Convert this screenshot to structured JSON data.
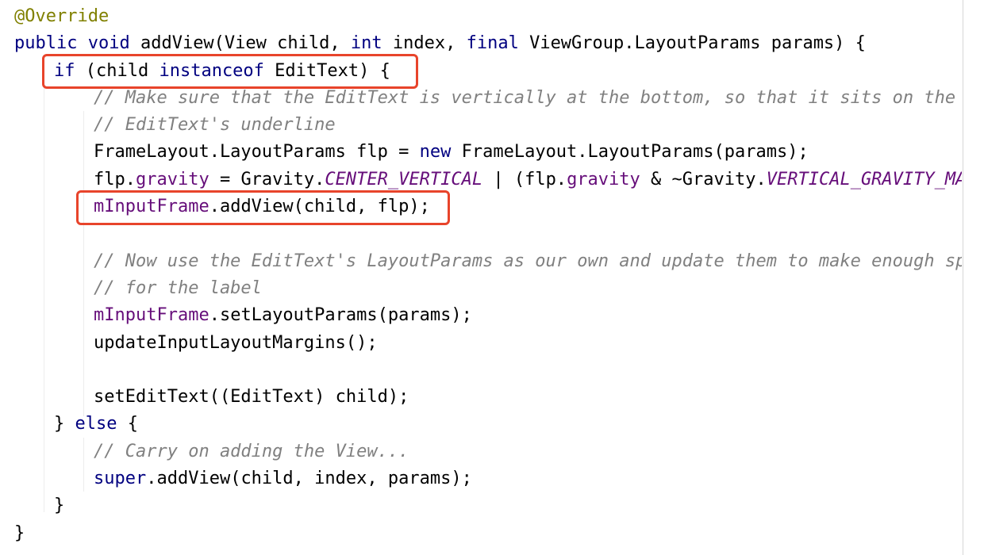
{
  "editor": {
    "colors": {
      "background": "#ffffff",
      "keyword": "#000080",
      "annotation": "#808000",
      "comment": "#808080",
      "field": "#660e7a",
      "highlight_box": "#e8442b"
    },
    "lines": [
      {
        "indent": 0,
        "tokens": [
          {
            "t": "@Override",
            "k": "anno"
          }
        ]
      },
      {
        "indent": 0,
        "tokens": [
          {
            "t": "public",
            "k": "kw"
          },
          {
            "t": " ",
            "k": "plain"
          },
          {
            "t": "void",
            "k": "kw"
          },
          {
            "t": " addView(View child, ",
            "k": "plain"
          },
          {
            "t": "int",
            "k": "kw"
          },
          {
            "t": " index, ",
            "k": "plain"
          },
          {
            "t": "final",
            "k": "kw"
          },
          {
            "t": " ViewGroup.LayoutParams params) {",
            "k": "plain"
          }
        ]
      },
      {
        "indent": 1,
        "tokens": [
          {
            "t": "if",
            "k": "kw"
          },
          {
            "t": " (child ",
            "k": "plain"
          },
          {
            "t": "instanceof",
            "k": "kw"
          },
          {
            "t": " EditText) {",
            "k": "plain"
          }
        ]
      },
      {
        "indent": 2,
        "tokens": [
          {
            "t": "// Make sure that the EditText is vertically at the bottom, so that it sits on the",
            "k": "comment"
          }
        ]
      },
      {
        "indent": 2,
        "tokens": [
          {
            "t": "// EditText's underline",
            "k": "comment"
          }
        ]
      },
      {
        "indent": 2,
        "tokens": [
          {
            "t": "FrameLayout.LayoutParams flp = ",
            "k": "plain"
          },
          {
            "t": "new",
            "k": "kw"
          },
          {
            "t": " FrameLayout.LayoutParams(params);",
            "k": "plain"
          }
        ]
      },
      {
        "indent": 2,
        "tokens": [
          {
            "t": "flp.",
            "k": "plain"
          },
          {
            "t": "gravity",
            "k": "field"
          },
          {
            "t": " = Gravity.",
            "k": "plain"
          },
          {
            "t": "CENTER_VERTICAL",
            "k": "static"
          },
          {
            "t": " | (flp.",
            "k": "plain"
          },
          {
            "t": "gravity",
            "k": "field"
          },
          {
            "t": " & ~Gravity.",
            "k": "plain"
          },
          {
            "t": "VERTICAL_GRAVITY_MASK",
            "k": "static"
          },
          {
            "t": ");",
            "k": "plain"
          }
        ]
      },
      {
        "indent": 2,
        "tokens": [
          {
            "t": "mInputFrame",
            "k": "field"
          },
          {
            "t": ".addView(child, flp);",
            "k": "plain"
          }
        ]
      },
      {
        "indent": 0,
        "tokens": []
      },
      {
        "indent": 2,
        "tokens": [
          {
            "t": "// Now use the EditText's LayoutParams as our own and update them to make enough space",
            "k": "comment"
          }
        ]
      },
      {
        "indent": 2,
        "tokens": [
          {
            "t": "// for the label",
            "k": "comment"
          }
        ]
      },
      {
        "indent": 2,
        "tokens": [
          {
            "t": "mInputFrame",
            "k": "field"
          },
          {
            "t": ".setLayoutParams(params);",
            "k": "plain"
          }
        ]
      },
      {
        "indent": 2,
        "tokens": [
          {
            "t": "updateInputLayoutMargins();",
            "k": "plain"
          }
        ]
      },
      {
        "indent": 0,
        "tokens": []
      },
      {
        "indent": 2,
        "tokens": [
          {
            "t": "setEditText((EditText) child);",
            "k": "plain"
          }
        ]
      },
      {
        "indent": 1,
        "tokens": [
          {
            "t": "} ",
            "k": "plain"
          },
          {
            "t": "else",
            "k": "kw"
          },
          {
            "t": " {",
            "k": "plain"
          }
        ]
      },
      {
        "indent": 2,
        "tokens": [
          {
            "t": "// Carry on adding the View...",
            "k": "comment"
          }
        ]
      },
      {
        "indent": 2,
        "tokens": [
          {
            "t": "super",
            "k": "kw"
          },
          {
            "t": ".addView(child, index, params);",
            "k": "plain"
          }
        ]
      },
      {
        "indent": 1,
        "tokens": [
          {
            "t": "}",
            "k": "plain"
          }
        ]
      },
      {
        "indent": 0,
        "tokens": [
          {
            "t": "}",
            "k": "plain"
          }
        ]
      }
    ],
    "highlights": [
      {
        "name": "highlight-instanceof-check",
        "line": 2
      },
      {
        "name": "highlight-addview-call",
        "line": 7
      }
    ]
  }
}
